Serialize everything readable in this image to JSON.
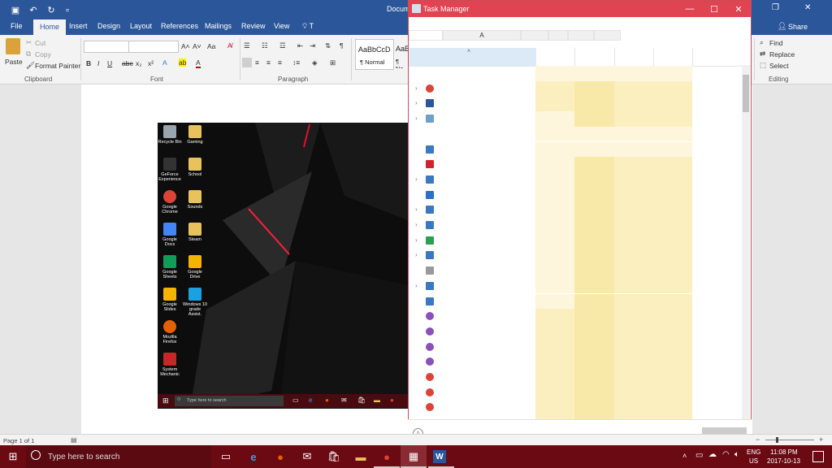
{
  "word": {
    "title_partial": "Docum",
    "share_label": "Share",
    "tabs": [
      "File",
      "Home",
      "Insert",
      "Design",
      "Layout",
      "References",
      "Mailings",
      "Review",
      "View"
    ],
    "tell_me_icon": "lightbulb-icon",
    "clipboard": {
      "paste": "Paste",
      "cut": "Cut",
      "copy": "Copy",
      "format_painter": "Format Painter",
      "label": "Clipboard"
    },
    "font": {
      "label": "Font",
      "bold": "B",
      "italic": "I",
      "underline": "U",
      "strike": "abc",
      "sub": "x₂",
      "sup": "x²",
      "grow": "A˄",
      "shrink": "A˅",
      "case": "Aa"
    },
    "paragraph": {
      "label": "Paragraph"
    },
    "styles": [
      {
        "preview": "AaBbCcD",
        "name": "¶ Normal"
      },
      {
        "preview": "AaB",
        "name": "¶ No"
      }
    ],
    "editing": {
      "label": "Editing",
      "find": "Find",
      "replace": "Replace",
      "select": "Select"
    },
    "status": {
      "page": "Page 1 of 1"
    }
  },
  "task_manager": {
    "title": "Task Manager",
    "tab_letter": "A",
    "rows": [
      {
        "expand": true,
        "icon": "chrome-icon",
        "color": "#db4437"
      },
      {
        "expand": true,
        "icon": "word-icon",
        "color": "#2b579a"
      },
      {
        "expand": true,
        "icon": "task-manager-icon",
        "color": "#6fa0c7"
      },
      {
        "expand": false,
        "icon": "",
        "color": ""
      },
      {
        "expand": false,
        "icon": "app-window-icon",
        "color": "#3a78c2"
      },
      {
        "expand": false,
        "icon": "red-app-icon",
        "color": "#d5202f"
      },
      {
        "expand": true,
        "icon": "app-window-icon",
        "color": "#3a78c2"
      },
      {
        "expand": false,
        "icon": "window-icon",
        "color": "#2a6fc9"
      },
      {
        "expand": true,
        "icon": "app-window-icon",
        "color": "#3a78c2"
      },
      {
        "expand": true,
        "icon": "app-window-icon",
        "color": "#3a78c2"
      },
      {
        "expand": true,
        "icon": "green-gear-icon",
        "color": "#2aa04f"
      },
      {
        "expand": true,
        "icon": "app-window-icon",
        "color": "#3a78c2"
      },
      {
        "expand": false,
        "icon": "printer-icon",
        "color": "#9a9a9a"
      },
      {
        "expand": true,
        "icon": "app-window-icon",
        "color": "#3a78c2"
      },
      {
        "expand": false,
        "icon": "app-window-icon",
        "color": "#3a78c2"
      },
      {
        "expand": false,
        "icon": "purple-circle-icon",
        "color": "#8a4fb8"
      },
      {
        "expand": false,
        "icon": "purple-circle-icon",
        "color": "#8a4fb8"
      },
      {
        "expand": false,
        "icon": "purple-circle-icon",
        "color": "#8a4fb8"
      },
      {
        "expand": false,
        "icon": "purple-circle-icon",
        "color": "#8a4fb8"
      },
      {
        "expand": false,
        "icon": "chrome-icon",
        "color": "#db4437"
      },
      {
        "expand": false,
        "icon": "chrome-icon",
        "color": "#db4437"
      },
      {
        "expand": false,
        "icon": "chrome-icon",
        "color": "#db4437"
      }
    ]
  },
  "desktop": {
    "icons": [
      {
        "label": "Recycle Bin",
        "color": "#9aa5ad"
      },
      {
        "label": "Gaming",
        "color": "#e8c35b"
      },
      {
        "label": "GeForce Experience",
        "color": "#333333"
      },
      {
        "label": "School",
        "color": "#e8c35b"
      },
      {
        "label": "Google Chrome",
        "color": "#db4437"
      },
      {
        "label": "Sounds",
        "color": "#e8c35b"
      },
      {
        "label": "Google Docs",
        "color": "#4285f4"
      },
      {
        "label": "Steam",
        "color": "#e8c35b"
      },
      {
        "label": "Google Sheets",
        "color": "#0f9d58"
      },
      {
        "label": "Google Drive",
        "color": "#f4b400"
      },
      {
        "label": "Google Slides",
        "color": "#f4b400"
      },
      {
        "label": "Windows 10 grade Assist.",
        "color": "#1ba1e2"
      },
      {
        "label": "Mozilla Firefox",
        "color": "#e66000"
      },
      {
        "label": "System Mechanic",
        "color": "#c62828"
      }
    ],
    "search_placeholder": "Type here to search"
  },
  "taskbar": {
    "search_placeholder": "Type here to search",
    "lang": "ENG",
    "region": "US",
    "time": "11:08 PM",
    "date": "2017-10-13"
  }
}
